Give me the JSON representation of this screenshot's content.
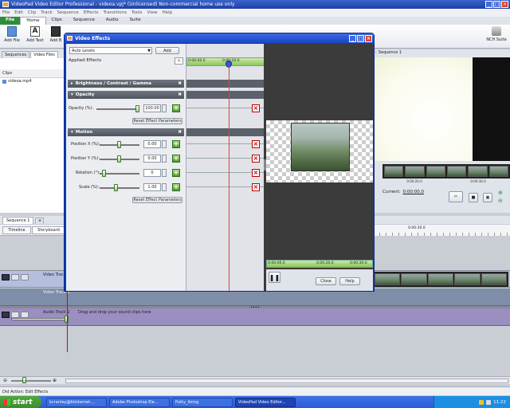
{
  "app_title": "VideoPad Video Editor Professional - videoa.vpj* (Unlicensed) Non-commercial home use only",
  "menu": [
    "File",
    "Edit",
    "Clip",
    "Track",
    "Sequence",
    "Effects",
    "Transitions",
    "Tools",
    "View",
    "Help"
  ],
  "ribbon_tabs": [
    "File",
    "Home",
    "Clips",
    "Sequence",
    "Audio",
    "Suite"
  ],
  "ribbon_buttons": {
    "add_file": "Add File",
    "add_text": "Add Text",
    "add_b": "Add B"
  },
  "nch_suite": "NCH Suite",
  "bin_tabs": {
    "sequences": "Sequences",
    "video_files": "Video Files"
  },
  "clips_header": "Clips",
  "clip_item": "videoa.mp4",
  "sequence_tab": "Sequence 1",
  "view_tabs": {
    "timeline": "Timeline",
    "storyboard": "Storyboard"
  },
  "preview_title": "Sequence 1",
  "preview_time_labels": [
    "0:00:20.0",
    "0:00:30.0"
  ],
  "current_label": "Current:",
  "current_value": "0:00:00.0",
  "timeline_ruler_label": "0:00:30.0",
  "tracks": {
    "video_track1": "Video Track 1",
    "video_track2": "Video Track 1",
    "audio_track": "Audio Track 1",
    "audio_hint": "Drag and drop your sound clips here"
  },
  "dialog": {
    "title": "Video Effects",
    "effect_dropdown": "Auto Levels",
    "add_label": "Add",
    "applied_effects": "Applied Effects",
    "ruler": [
      "0:00:00.0",
      "0:00:20.0"
    ],
    "sections": {
      "brightness": "Brightness / Contrast / Gamma",
      "opacity": "Opacity",
      "motion": "Motion"
    },
    "params": {
      "opacity_label": "Opacity (%):",
      "opacity_value": "100.00",
      "reset_label": "Reset Effect Parameters",
      "pos_x_label": "Position X (%):",
      "pos_x_value": "0.00",
      "pos_y_label": "Position Y (%):",
      "pos_y_value": "0.00",
      "rotation_label": "Rotation (°):",
      "rotation_value": "0",
      "scale_label": "Scale (%):",
      "scale_value": "1.00",
      "reset_label2": "Reset Effect Parameters"
    },
    "preview_ruler": [
      "0:00:00.0",
      "0:00:20.0",
      "0:00:30.0"
    ],
    "close_label": "Close",
    "help_label": "Help"
  },
  "status_text": "Did Action: Edit Effects",
  "taskbar": {
    "start": "start",
    "items": [
      "kcranley@btinternet....",
      "Adobe Photoshop Ele...",
      "Putty_lining",
      "VideoPad Video Editor..."
    ],
    "clock": "11:22"
  },
  "colors": {
    "titlebar": "#1e3fa8",
    "taskbar": "#2a5bd7",
    "start": "#3c8d2e",
    "ribbon_file": "#2f8d3a",
    "timeline_track": "#b6bedd",
    "audio_track": "#9a8fc0"
  }
}
